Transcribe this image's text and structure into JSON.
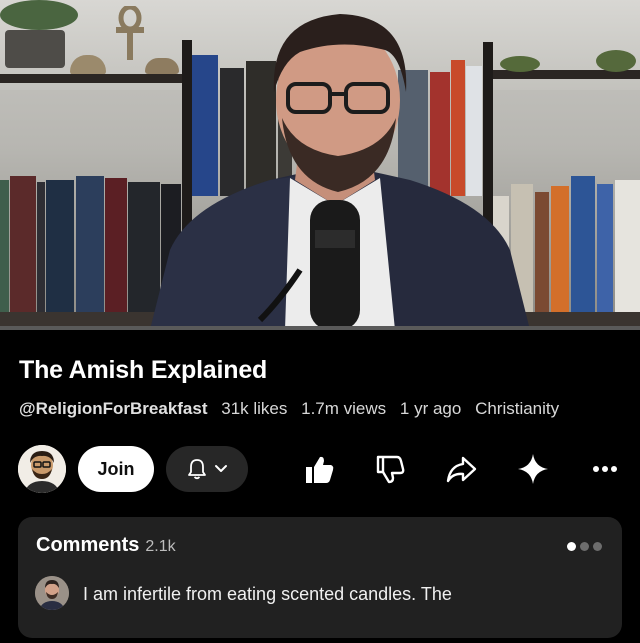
{
  "video": {
    "progress_fraction": 0.0
  },
  "info": {
    "title": "The Amish Explained",
    "channel": "@ReligionForBreakfast",
    "likes": "31k likes",
    "views": "1.7m views",
    "age": "1 yr ago",
    "category": "Christianity"
  },
  "actions": {
    "join_label": "Join",
    "icons": [
      "bell-icon",
      "chevron-down-icon",
      "like-icon",
      "dislike-icon",
      "share-icon",
      "sparkle-icon",
      "more-icon"
    ]
  },
  "comments": {
    "title": "Comments",
    "count": "2.1k",
    "top_comment": "I am infertile from eating scented candles. The"
  },
  "colors": {
    "background": "#000000",
    "card": "#212121",
    "pill_dark": "#272727",
    "accent": "#ff0000"
  }
}
